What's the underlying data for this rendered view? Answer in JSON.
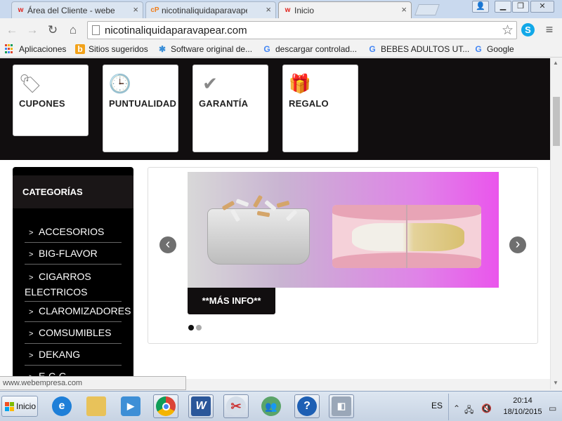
{
  "browser": {
    "tabs": [
      {
        "title": "Área del Cliente - webemp",
        "icon": "w",
        "active": false
      },
      {
        "title": "nicotinaliquidaparavapear",
        "icon": "cP",
        "active": false
      },
      {
        "title": "Inicio",
        "icon": "w",
        "active": true
      }
    ],
    "close_glyph": "×",
    "url": "nicotinaliquidaparavapear.com",
    "bookmarks": [
      {
        "label": "Aplicaciones",
        "icon": "apps-grid-icon"
      },
      {
        "label": "Sitios sugeridos",
        "icon": "b"
      },
      {
        "label": "Software original de...",
        "icon": "✱"
      },
      {
        "label": "descargar controlad...",
        "icon": "G"
      },
      {
        "label": "BEBES ADULTOS UT...",
        "icon": "G"
      },
      {
        "label": "Google",
        "icon": "G"
      }
    ],
    "status_url": "www.webempresa.com"
  },
  "page": {
    "feature_cards": [
      {
        "label": "CUPONES",
        "icon": "tag-icon",
        "glyph": "🏷"
      },
      {
        "label": "PUNTUALIDAD",
        "icon": "clock-icon",
        "glyph": "🕒"
      },
      {
        "label": "GARANTÍA",
        "icon": "check-icon",
        "glyph": "✔"
      },
      {
        "label": "REGALO",
        "icon": "gift-icon",
        "glyph": "🎁"
      }
    ],
    "sidebar": {
      "title": "CATEGORÍAS",
      "items": [
        "ACCESORIOS",
        "BIG-FLAVOR",
        "CIGARROS ELECTRICOS",
        "CLAROMIZADORES",
        "COMSUMIBLES",
        "DEKANG",
        "E-C-G"
      ]
    },
    "slider": {
      "prev_glyph": "‹",
      "next_glyph": "›",
      "cta_label": "**MÁS INFO**",
      "dots": 2,
      "active_dot": 0
    }
  },
  "taskbar": {
    "start_label": "Inicio",
    "language": "ES",
    "time": "20:14",
    "date": "18/10/2015"
  },
  "colors": {
    "dark_band": "#110e0f",
    "accent_red": "#e0231c",
    "skype_blue": "#11a8e8"
  }
}
